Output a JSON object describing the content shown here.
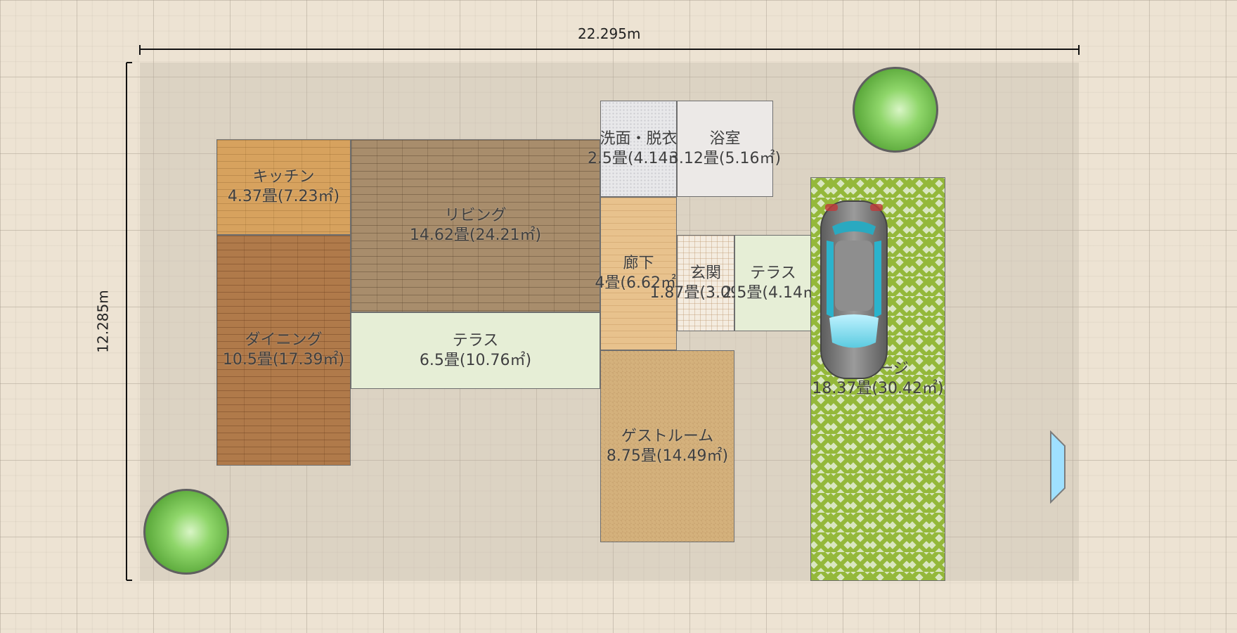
{
  "dimensions": {
    "width_label": "22.295m",
    "height_label": "12.285m"
  },
  "rooms": {
    "kitchen": {
      "name": "キッチン",
      "area": "4.37畳(7.23㎡)"
    },
    "living": {
      "name": "リビング",
      "area": "14.62畳(24.21㎡)"
    },
    "dining": {
      "name": "ダイニング",
      "area": "10.5畳(17.39㎡)"
    },
    "terrace_main": {
      "name": "テラス",
      "area": "6.5畳(10.76㎡)"
    },
    "washroom": {
      "name": "洗面・脱衣",
      "area": "2.5畳(4.14㎡)"
    },
    "bathroom": {
      "name": "浴室",
      "area": "3.12畳(5.16㎡)"
    },
    "hallway": {
      "name": "廊下",
      "area": "4畳(6.62㎡)"
    },
    "entrance": {
      "name": "玄関",
      "area": "1.87畳(3.09㎡)"
    },
    "terrace_entry": {
      "name": "テラス",
      "area": "2.5畳(4.14㎡)"
    },
    "guest_room": {
      "name": "ゲストルーム",
      "area": "8.75畳(14.49㎡)"
    },
    "garage": {
      "name": "ガレージ",
      "area": "18.37畳(30.42㎡)"
    }
  },
  "colors": {
    "background": "#ede3d3",
    "tree": "#7ccf5a",
    "window": "#9fe0ff",
    "car": "#808080"
  },
  "icons": [
    "tree-icon",
    "car-icon",
    "window-icon"
  ]
}
